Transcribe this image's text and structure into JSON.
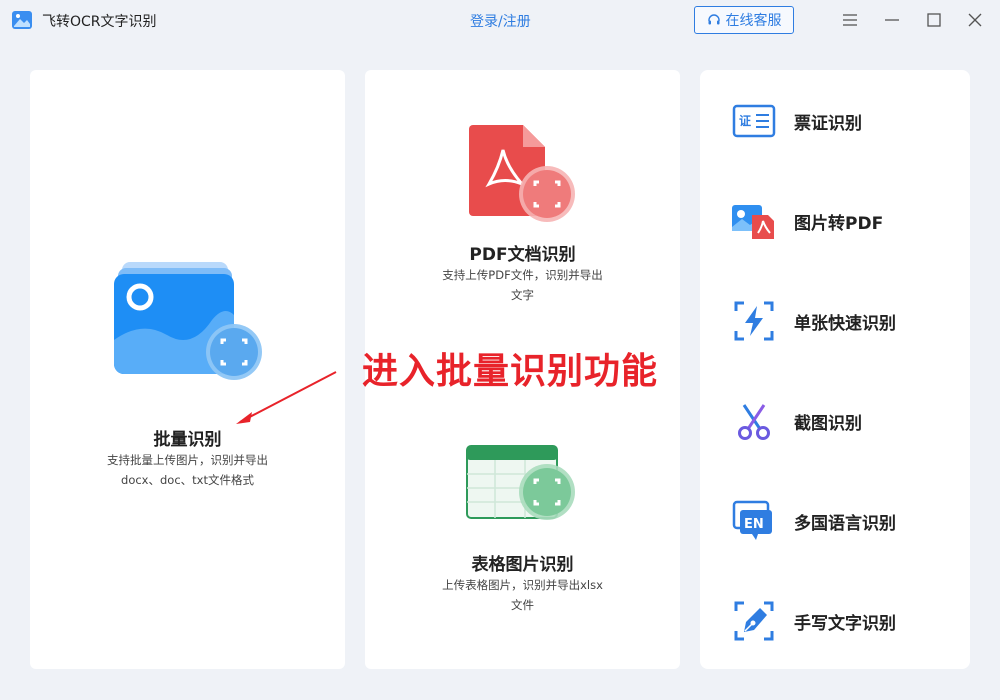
{
  "app": {
    "title": "飞转OCR文字识别"
  },
  "header": {
    "login": "登录/注册",
    "support": "在线客服"
  },
  "features": {
    "batch": {
      "title": "批量识别",
      "desc1": "支持批量上传图片，识别并导出",
      "desc2": "docx、doc、txt文件格式"
    },
    "pdf": {
      "title": "PDF文档识别",
      "desc1": "支持上传PDF文件，识别并导出",
      "desc2": "文字"
    },
    "table": {
      "title": "表格图片识别",
      "desc1": "上传表格图片，识别并导出xlsx",
      "desc2": "文件"
    }
  },
  "sidebar": {
    "items": [
      {
        "label": "票证识别",
        "icon": "id-card-icon"
      },
      {
        "label": "图片转PDF",
        "icon": "image-to-pdf-icon"
      },
      {
        "label": "单张快速识别",
        "icon": "lightning-scan-icon"
      },
      {
        "label": "截图识别",
        "icon": "scissors-icon"
      },
      {
        "label": "多国语言识别",
        "icon": "language-en-icon"
      },
      {
        "label": "手写文字识别",
        "icon": "pen-nib-icon"
      }
    ]
  },
  "annotation": {
    "text": "进入批量识别功能"
  },
  "colors": {
    "accent": "#2f7de1",
    "annotation": "#e8232a",
    "pdf_red": "#e84c4c",
    "table_green": "#2e9a5a",
    "batch_blue": "#1e8ef5"
  }
}
